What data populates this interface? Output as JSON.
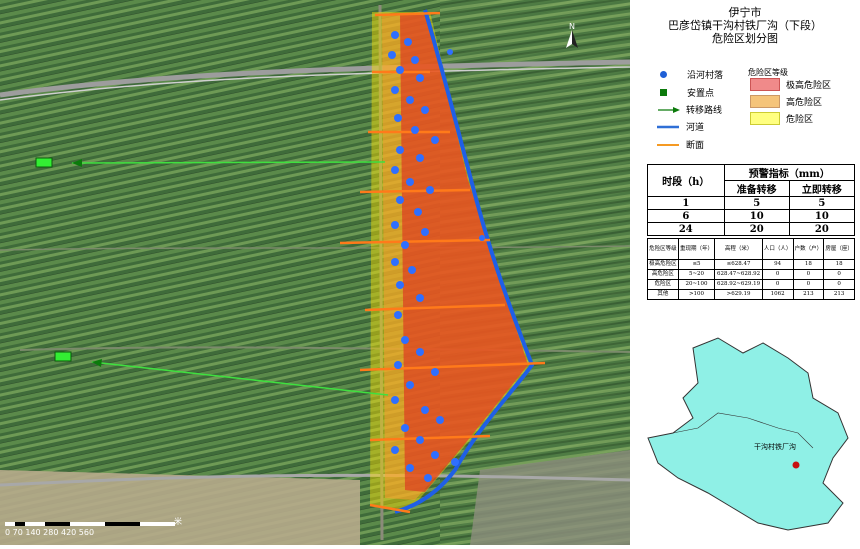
{
  "title": {
    "line1": "伊宁市",
    "line2": "巴彦岱镇干沟村铁厂沟（下段）",
    "line3": "危险区划分图"
  },
  "map": {
    "north_label": "N",
    "scale_text": "0  70 140    280    420    560",
    "scale_unit": "米"
  },
  "legend": {
    "items": [
      {
        "label": "沿河村落",
        "icon": "blue-dot-icon",
        "color": "#1f5fd6"
      },
      {
        "label": "安置点",
        "icon": "green-square-icon",
        "color": "#0b7a0b"
      },
      {
        "label": "转移路线",
        "icon": "arrow-icon",
        "color": "#0b7a0b"
      },
      {
        "label": "河道",
        "icon": "river-line-icon",
        "color": "#2f6fd6"
      },
      {
        "label": "断面",
        "icon": "section-line-icon",
        "color": "#f59a23"
      }
    ],
    "zone_title": "危险区等级",
    "zones": [
      {
        "label": "极高危险区",
        "color": "#f08a8a"
      },
      {
        "label": "高危险区",
        "color": "#f5c47a"
      },
      {
        "label": "危险区",
        "color": "#ffff80"
      }
    ]
  },
  "warning_table": {
    "header_period": "时段（h）",
    "header_indicator": "预警指标（mm）",
    "sub_prepare": "准备转移",
    "sub_immediate": "立即转移",
    "rows": [
      [
        "1",
        "5",
        "5"
      ],
      [
        "6",
        "10",
        "10"
      ],
      [
        "24",
        "20",
        "20"
      ]
    ]
  },
  "zone_table": {
    "headers": [
      "危险区等级",
      "重现期（年）",
      "高程（米）",
      "人口（人）",
      "户数（户）",
      "房屋（座）"
    ],
    "rows": [
      [
        "极高危险区",
        "≤5",
        "≤628.47",
        "94",
        "18",
        "18"
      ],
      [
        "高危险区",
        "5~20",
        "628.47~628.92",
        "0",
        "0",
        "0"
      ],
      [
        "危险区",
        "20~100",
        "628.92~629.19",
        "0",
        "0",
        "0"
      ],
      [
        "其他",
        ">100",
        ">629.19",
        "1062",
        "213",
        "213"
      ]
    ]
  },
  "inset": {
    "label": "干沟村铁厂沟",
    "fill": "#8ff0e6"
  }
}
